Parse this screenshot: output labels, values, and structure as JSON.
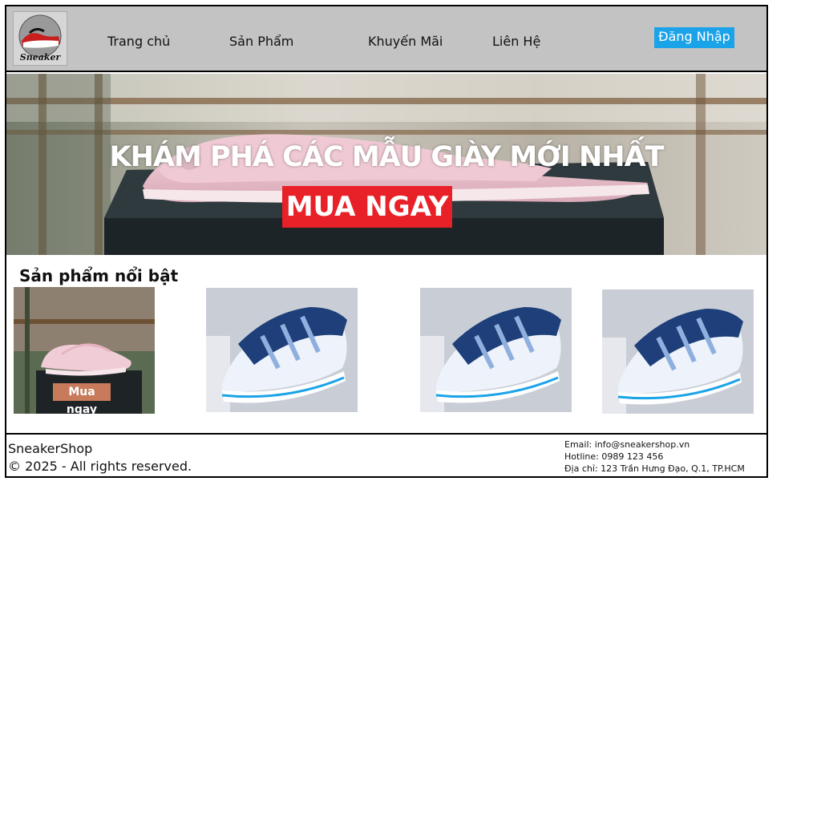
{
  "header": {
    "logo_alt": "sneaker-logo-icon",
    "nav": [
      "Trang chủ",
      "Sản Phẩm",
      "Khuyến Mãi",
      "Liên Hệ"
    ],
    "login_label": "Đăng Nhập",
    "login_color": "#1aa3e8",
    "bg_color": "#c3c3c3"
  },
  "hero": {
    "title": "KHÁM PHÁ CÁC MẪU GIÀY MỚI NHẤT",
    "cta_label": "MUA NGAY",
    "cta_color": "#e82027"
  },
  "featured": {
    "title": "Sản phẩm nổi bật",
    "products": [
      {
        "image": "pink-sneaker-image",
        "cta_label": "Mua ngay"
      },
      {
        "image": "blue-white-sneaker-image"
      },
      {
        "image": "blue-white-sneaker-image"
      },
      {
        "image": "blue-white-sneaker-image"
      }
    ]
  },
  "footer": {
    "brand": "SneakerShop",
    "copyright": "© 2025 - All rights reserved.",
    "email": "Email: info@sneakershop.vn",
    "hotline": "Hotline: 0989 123 456",
    "address": "Địa chỉ: 123 Trần Hưng Đạo, Q.1, TP.HCM"
  }
}
